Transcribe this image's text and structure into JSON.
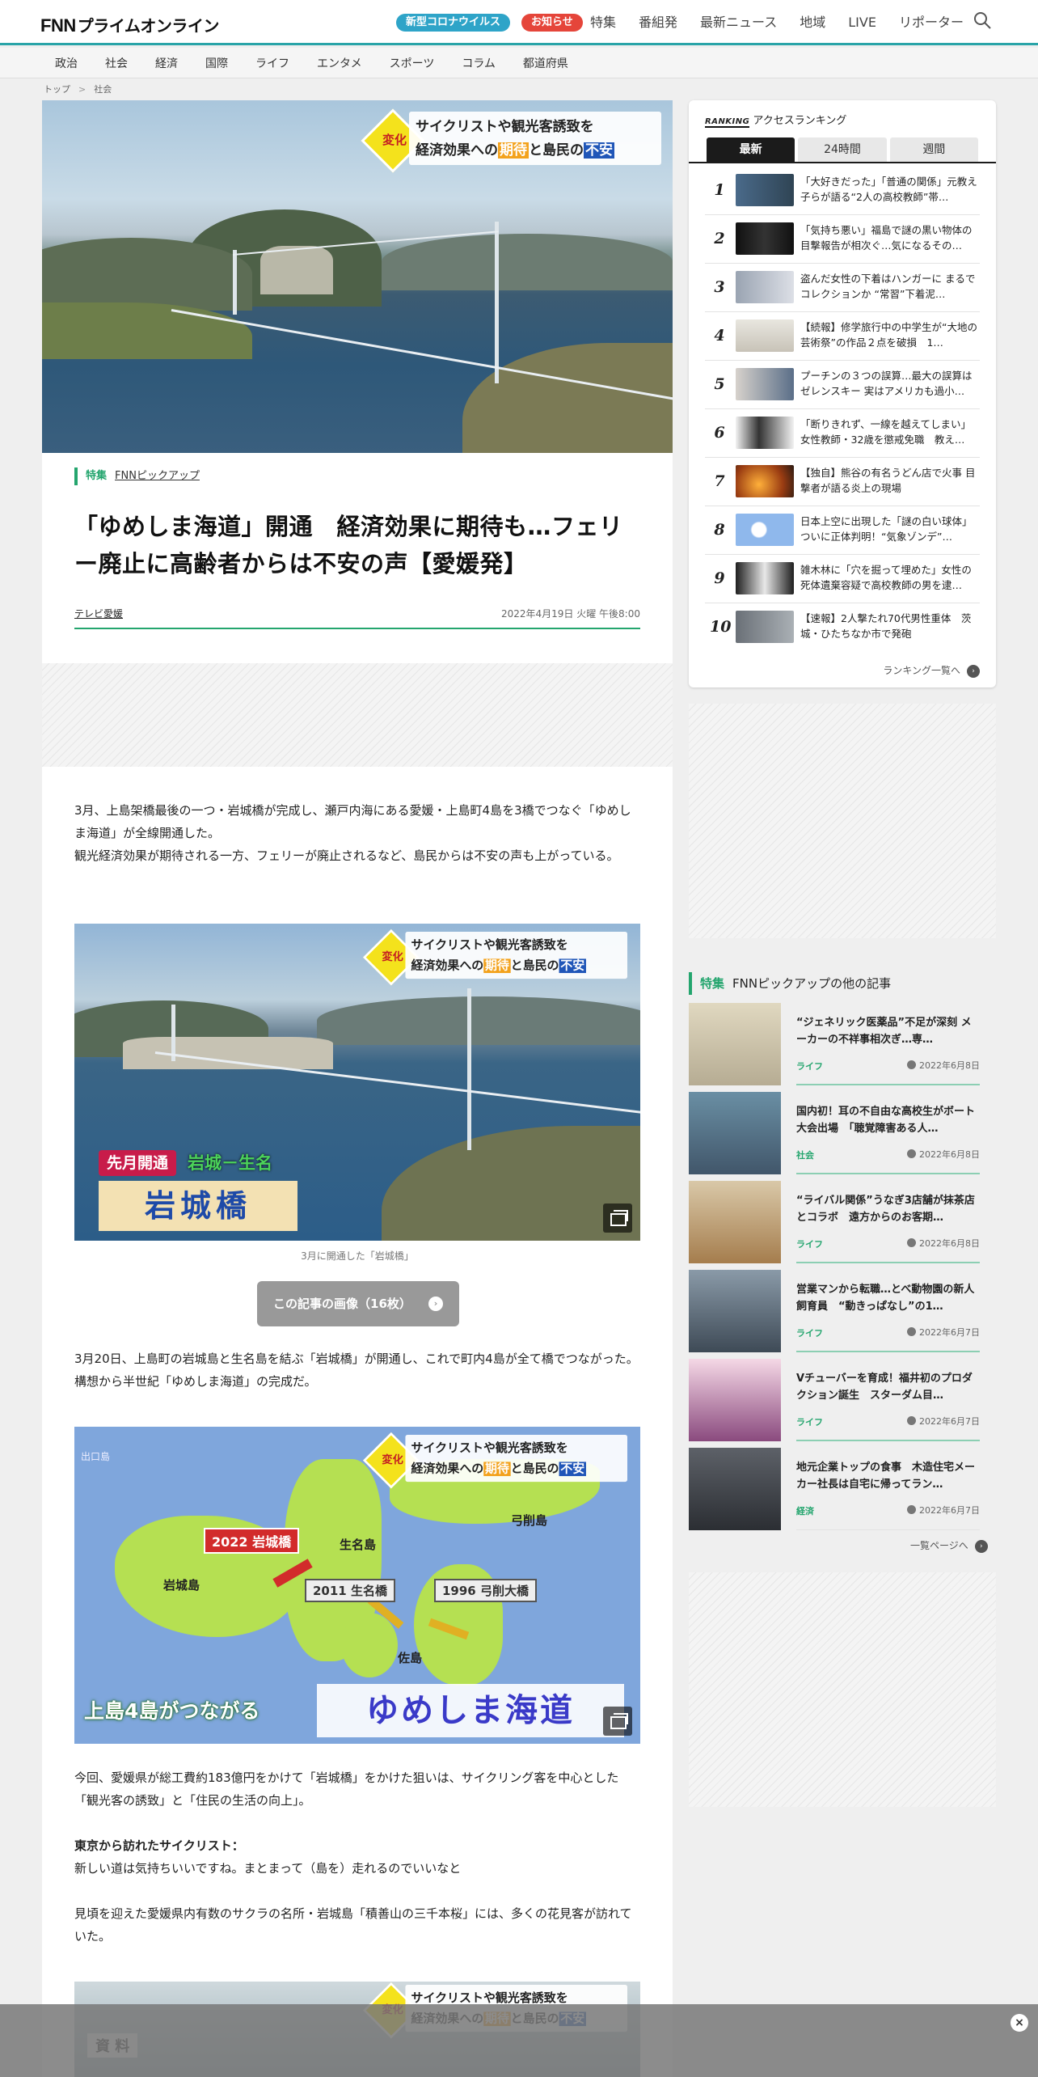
{
  "header": {
    "logo_fnn": "FNN",
    "logo_text": "プライムオンライン",
    "covid_pill": "新型コロナウイルス",
    "notice_pill": "お知らせ",
    "nav": [
      "特集",
      "番組発",
      "最新ニュース",
      "地域",
      "LIVE",
      "リポーター"
    ]
  },
  "catnav": [
    "政治",
    "社会",
    "経済",
    "国際",
    "ライフ",
    "エンタメ",
    "スポーツ",
    "コラム",
    "都道府県"
  ],
  "breadcrumb": {
    "top": "トップ",
    "sep": ">",
    "current": "社会"
  },
  "hero_banner": {
    "tag": "変化",
    "line1": "サイクリストや観光客誘致を",
    "line2a": "経済効果への",
    "line2b": "期待",
    "line2c": "と島民の",
    "line2d": "不安"
  },
  "article": {
    "tag1": "特集",
    "tag2": "FNNピックアップ",
    "title": "「ゆめしま海道」開通　経済効果に期待も…フェリー廃止に高齢者からは不安の声【愛媛発】",
    "source": "テレビ愛媛",
    "date": "2022年4月19日 火曜 午後8:00",
    "p1": "3月、上島架橋最後の一つ・岩城橋が完成し、瀬戸内海にある愛媛・上島町4島を3橋でつなぐ「ゆめしま海道」が全線開通した。",
    "p2": "観光経済効果が期待される一方、フェリーが廃止されるなど、島民からは不安の声も上がっている。",
    "img2_label_small": "先月開通",
    "img2_label_route": "岩城－生名",
    "img2_label_big": "岩城橋",
    "caption1": "3月に開通した「岩城橋」",
    "gallery_button": "この記事の画像（16枚）",
    "p3": "3月20日、上島町の岩城島と生名島を結ぶ「岩城橋」が開通し、これで町内4島が全て橋でつながった。構想から半世紀「ゆめしま海道」の完成だ。",
    "map": {
      "corner": "出口島",
      "island1": "岩城島",
      "island2": "生名島",
      "island3": "弓削島",
      "island4": "佐島",
      "bridge1": "2022 岩城橋",
      "bridge2": "2011 生名橋",
      "bridge3": "1996 弓削大橋",
      "footer_left": "上島4島がつながる",
      "footer_right": "ゆめしま海道"
    },
    "p4": "今回、愛媛県が総工費約183億円をかけて「岩城橋」をかけた狙いは、サイクリング客を中心とした「観光客の誘致」と「住民の生活の向上」。",
    "p5_bold": "東京から訪れたサイクリスト：",
    "p5": "新しい道は気持ちいいですね。まとまって（島を）走れるのでいいなと",
    "p6": "見頃を迎えた愛媛県内有数のサクラの名所・岩城島「積善山の三千本桜」には、多くの花見客が訪れていた。",
    "img4_label": "資 料"
  },
  "ranking": {
    "header_badge": "RANKING",
    "header": "アクセスランキング",
    "tabs": [
      "最新",
      "24時間",
      "週間"
    ],
    "items": [
      {
        "n": "1",
        "t": "「大好きだった」「普通の関係」元教え子らが語る“2人の高校教師”帯…"
      },
      {
        "n": "2",
        "t": "「気持ち悪い」福島で謎の黒い物体の目撃報告が相次ぐ…気になるその…"
      },
      {
        "n": "3",
        "t": "盗んだ女性の下着はハンガーに まるでコレクションか “常習”下着泥…"
      },
      {
        "n": "4",
        "t": "【続報】修学旅行中の中学生が“大地の芸術祭”の作品２点を破損　1…"
      },
      {
        "n": "5",
        "t": "プーチンの３つの誤算…最大の誤算はゼレンスキー 実はアメリカも過小…"
      },
      {
        "n": "6",
        "t": "「断りきれず、一線を越えてしまい」女性教師・32歳を懲戒免職　教え…"
      },
      {
        "n": "7",
        "t": "【独自】熊谷の有名うどん店で火事 目撃者が語る炎上の現場"
      },
      {
        "n": "8",
        "t": "日本上空に出現した「謎の白い球体」ついに正体判明！“気象ゾンデ”…"
      },
      {
        "n": "9",
        "t": "雑木林に「穴を掘って埋めた」女性の死体遺棄容疑で高校教師の男を逮…"
      },
      {
        "n": "10",
        "t": "【速報】2人撃たれ70代男性重体　茨城・ひたちなか市で発砲"
      }
    ],
    "more": "ランキング一覧へ"
  },
  "pickup": {
    "tag1": "特集",
    "tag2": "FNNピックアップの他の記事",
    "items": [
      {
        "t": "“ジェネリック医薬品”不足が深刻 メーカーの不祥事相次ぎ…専…",
        "c": "ライフ",
        "d": "2022年6月8日"
      },
      {
        "t": "国内初！耳の不自由な高校生がボート大会出場　「聴覚障害ある人…",
        "c": "社会",
        "d": "2022年6月8日"
      },
      {
        "t": "“ライバル関係”うなぎ3店舗が抹茶店とコラボ　遠方からのお客期…",
        "c": "ライフ",
        "d": "2022年6月8日"
      },
      {
        "t": "営業マンから転職…とべ動物園の新人飼育員　“動きっぱなし”の1…",
        "c": "ライフ",
        "d": "2022年6月7日"
      },
      {
        "t": "Vチューバーを育成！福井初のプロダクション誕生　スターダム目…",
        "c": "ライフ",
        "d": "2022年6月7日"
      },
      {
        "t": "地元企業トップの食事　木造住宅メーカー社長は自宅に帰ってラン…",
        "c": "経済",
        "d": "2022年6月7日"
      }
    ],
    "more": "一覧ページへ"
  },
  "bottom_close": "×"
}
